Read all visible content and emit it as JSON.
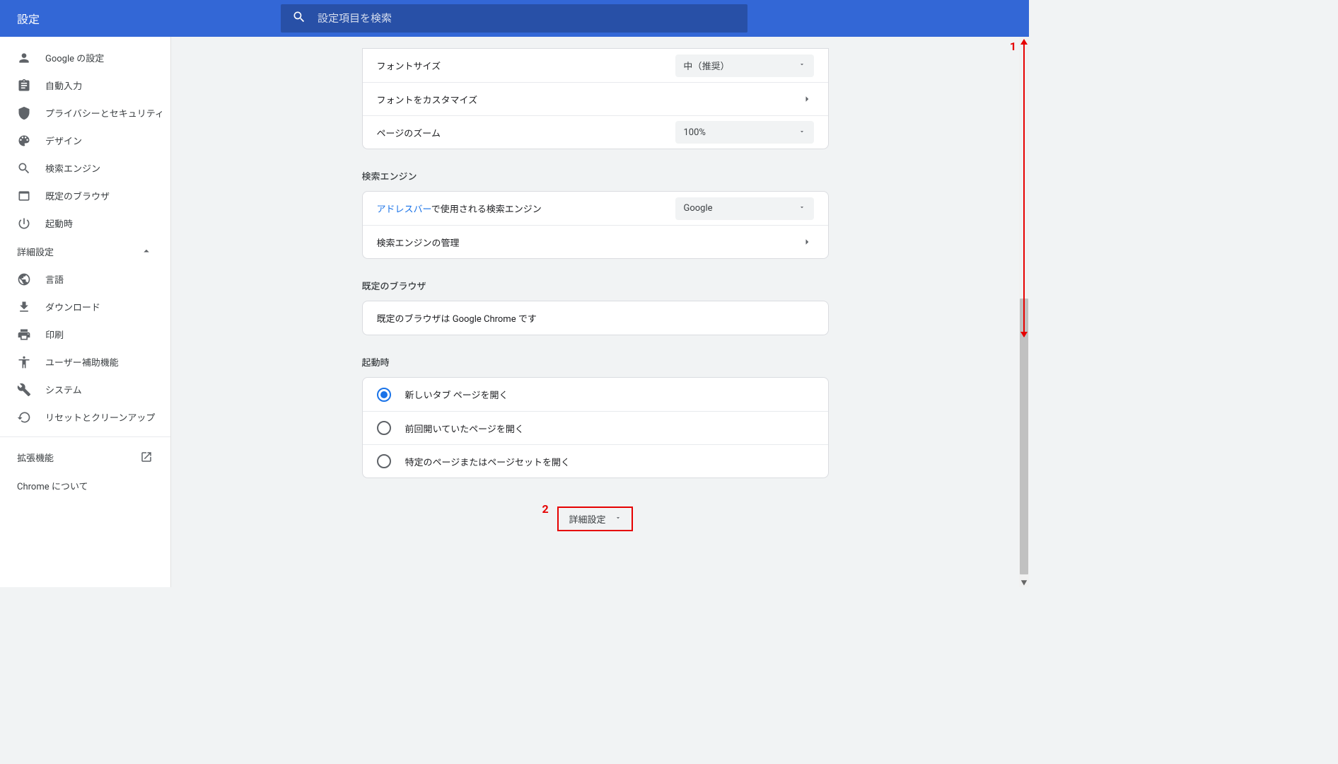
{
  "header": {
    "title": "設定",
    "search_placeholder": "設定項目を検索"
  },
  "sidebar": {
    "items": [
      {
        "label": "Google の設定"
      },
      {
        "label": "自動入力"
      },
      {
        "label": "プライバシーとセキュリティ"
      },
      {
        "label": "デザイン"
      },
      {
        "label": "検索エンジン"
      },
      {
        "label": "既定のブラウザ"
      },
      {
        "label": "起動時"
      }
    ],
    "advanced_label": "詳細設定",
    "adv_items": [
      {
        "label": "言語"
      },
      {
        "label": "ダウンロード"
      },
      {
        "label": "印刷"
      },
      {
        "label": "ユーザー補助機能"
      },
      {
        "label": "システム"
      },
      {
        "label": "リセットとクリーンアップ"
      }
    ],
    "extensions_label": "拡張機能",
    "about_label": "Chrome について"
  },
  "appearance": {
    "font_size_label": "フォントサイズ",
    "font_size_value": "中（推奨）",
    "customize_fonts_label": "フォントをカスタマイズ",
    "zoom_label": "ページのズーム",
    "zoom_value": "100%"
  },
  "search_engine": {
    "section_title": "検索エンジン",
    "addressbar_link": "アドレスバー",
    "addressbar_suffix": "で使用される検索エンジン",
    "engine_value": "Google",
    "manage_label": "検索エンジンの管理"
  },
  "default_browser": {
    "section_title": "既定のブラウザ",
    "text": "既定のブラウザは Google Chrome です"
  },
  "startup": {
    "section_title": "起動時",
    "options": [
      "新しいタブ ページを開く",
      "前回開いていたページを開く",
      "特定のページまたはページセットを開く"
    ],
    "selected": 0
  },
  "advanced_button": "詳細設定",
  "annotations": {
    "one": "1",
    "two": "2"
  }
}
